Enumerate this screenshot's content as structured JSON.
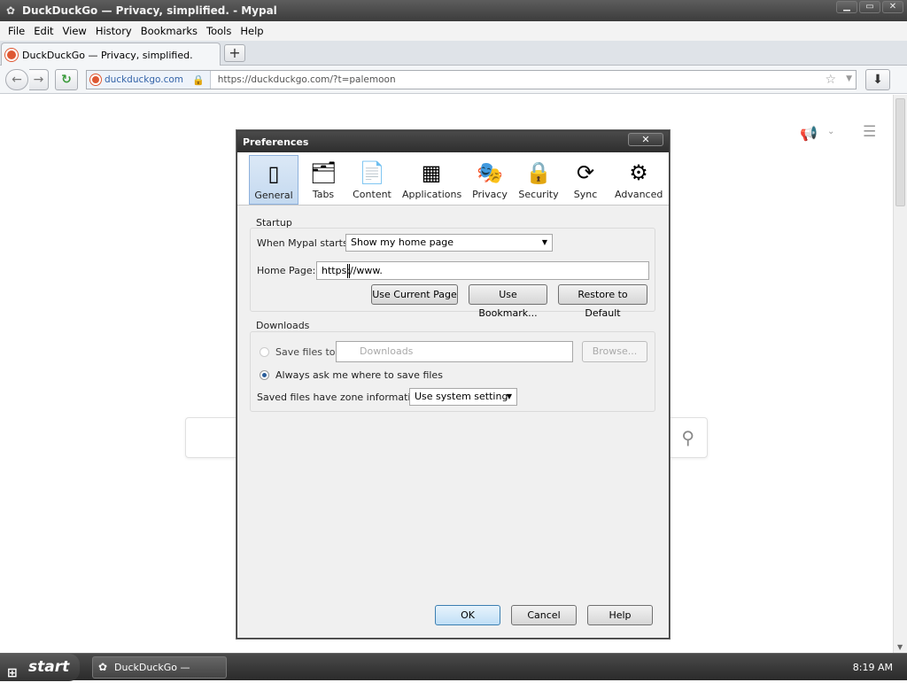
{
  "window": {
    "title": "DuckDuckGo — Privacy, simplified. - Mypal",
    "min": "▁",
    "max": "▭",
    "close": "✕"
  },
  "menu": [
    "File",
    "Edit",
    "View",
    "History",
    "Bookmarks",
    "Tools",
    "Help"
  ],
  "tab": {
    "label": "DuckDuckGo — Privacy, simplified.",
    "new_tab": "+"
  },
  "nav": {
    "identity": "duckduckgo.com",
    "url": "https://duckduckgo.com/?t=palemoon"
  },
  "dialog": {
    "title": "Preferences",
    "close": "✕",
    "panes": [
      "General",
      "Tabs",
      "Content",
      "Applications",
      "Privacy",
      "Security",
      "Sync",
      "Advanced"
    ],
    "startup": {
      "caption": "Startup",
      "when_label": "When Mypal starts:",
      "when_value": "Show my home page",
      "home_label": "Home Page:",
      "home_value": "https://www.",
      "use_current": "Use Current Page",
      "use_bookmark": "Use Bookmark...",
      "restore": "Restore to Default"
    },
    "downloads": {
      "caption": "Downloads",
      "save_to": "Save files to",
      "folder": "Downloads",
      "browse": "Browse...",
      "always_ask": "Always ask me where to save files",
      "zone_label": "Saved files have zone information:",
      "zone_value": "Use system setting"
    },
    "ok": "OK",
    "cancel": "Cancel",
    "help": "Help"
  },
  "taskbar": {
    "start": "start",
    "item": "DuckDuckGo — Privac...",
    "clock": "8:19 AM"
  },
  "colors": {
    "accent": "#de5833",
    "titlebar": "#3c3c3c",
    "selected_pane": "#c4d9f0"
  }
}
